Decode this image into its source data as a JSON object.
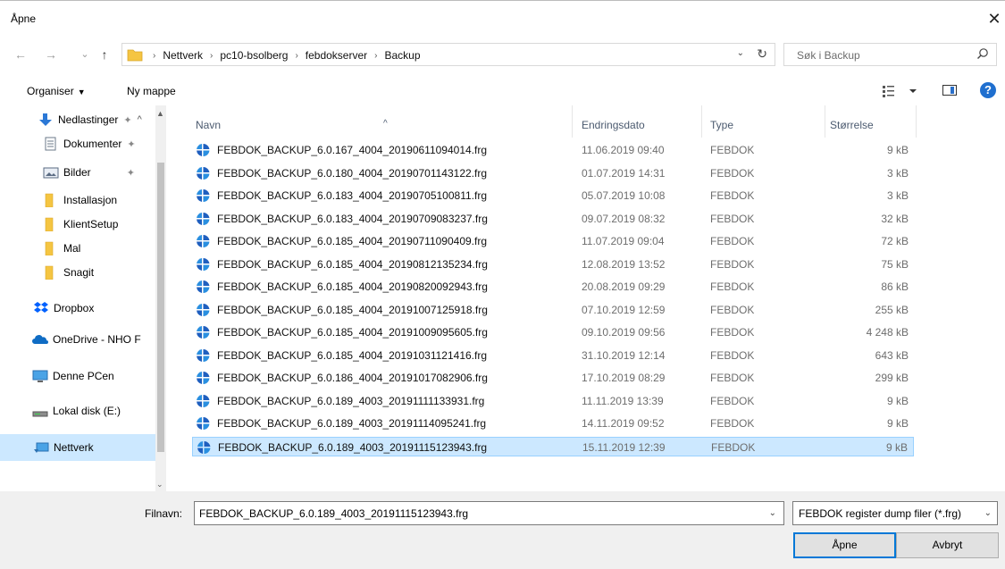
{
  "window": {
    "title": "Åpne",
    "close_glyph": "✕"
  },
  "nav": {
    "back": "←",
    "forward": "→",
    "recent": "⌄",
    "up": "↑",
    "breadcrumb": [
      "Nettverk",
      "pc10-bsolberg",
      "febdokserver",
      "Backup"
    ],
    "search_placeholder": "Søk i Backup"
  },
  "toolbar": {
    "organize": "Organiser",
    "new_folder": "Ny mappe",
    "help": "?"
  },
  "sidebar": {
    "items": [
      {
        "label": "Nedlastinger",
        "icon": "download-icon",
        "pinned": true
      },
      {
        "label": "Dokumenter",
        "icon": "documents-icon",
        "pinned": true
      },
      {
        "label": "Bilder",
        "icon": "pictures-icon",
        "pinned": true
      },
      {
        "label": "Installasjon",
        "icon": "folder-icon"
      },
      {
        "label": "KlientSetup",
        "icon": "folder-icon"
      },
      {
        "label": "Mal",
        "icon": "folder-icon"
      },
      {
        "label": "Snagit",
        "icon": "folder-icon"
      },
      {
        "label": "Dropbox",
        "icon": "dropbox-icon"
      },
      {
        "label": "OneDrive - NHO F",
        "icon": "onedrive-icon"
      },
      {
        "label": "Denne PCen",
        "icon": "computer-icon"
      },
      {
        "label": "Lokal disk (E:)",
        "icon": "drive-icon"
      },
      {
        "label": "Nettverk",
        "icon": "network-icon",
        "selected": true
      }
    ]
  },
  "columns": {
    "name": "Navn",
    "date": "Endringsdato",
    "type": "Type",
    "size": "Størrelse"
  },
  "files": [
    {
      "name": "FEBDOK_BACKUP_6.0.167_4004_20190611094014.frg",
      "date": "11.06.2019 09:40",
      "type": "FEBDOK",
      "size": "9 kB"
    },
    {
      "name": "FEBDOK_BACKUP_6.0.180_4004_20190701143122.frg",
      "date": "01.07.2019 14:31",
      "type": "FEBDOK",
      "size": "3 kB"
    },
    {
      "name": "FEBDOK_BACKUP_6.0.183_4004_20190705100811.frg",
      "date": "05.07.2019 10:08",
      "type": "FEBDOK",
      "size": "3 kB"
    },
    {
      "name": "FEBDOK_BACKUP_6.0.183_4004_20190709083237.frg",
      "date": "09.07.2019 08:32",
      "type": "FEBDOK",
      "size": "32 kB"
    },
    {
      "name": "FEBDOK_BACKUP_6.0.185_4004_20190711090409.frg",
      "date": "11.07.2019 09:04",
      "type": "FEBDOK",
      "size": "72 kB"
    },
    {
      "name": "FEBDOK_BACKUP_6.0.185_4004_20190812135234.frg",
      "date": "12.08.2019 13:52",
      "type": "FEBDOK",
      "size": "75 kB"
    },
    {
      "name": "FEBDOK_BACKUP_6.0.185_4004_20190820092943.frg",
      "date": "20.08.2019 09:29",
      "type": "FEBDOK",
      "size": "86 kB"
    },
    {
      "name": "FEBDOK_BACKUP_6.0.185_4004_20191007125918.frg",
      "date": "07.10.2019 12:59",
      "type": "FEBDOK",
      "size": "255 kB"
    },
    {
      "name": "FEBDOK_BACKUP_6.0.185_4004_20191009095605.frg",
      "date": "09.10.2019 09:56",
      "type": "FEBDOK",
      "size": "4 248 kB"
    },
    {
      "name": "FEBDOK_BACKUP_6.0.185_4004_20191031121416.frg",
      "date": "31.10.2019 12:14",
      "type": "FEBDOK",
      "size": "643 kB"
    },
    {
      "name": "FEBDOK_BACKUP_6.0.186_4004_20191017082906.frg",
      "date": "17.10.2019 08:29",
      "type": "FEBDOK",
      "size": "299 kB"
    },
    {
      "name": "FEBDOK_BACKUP_6.0.189_4003_20191111133931.frg",
      "date": "11.11.2019 13:39",
      "type": "FEBDOK",
      "size": "9 kB"
    },
    {
      "name": "FEBDOK_BACKUP_6.0.189_4003_20191114095241.frg",
      "date": "14.11.2019 09:52",
      "type": "FEBDOK",
      "size": "9 kB"
    },
    {
      "name": "FEBDOK_BACKUP_6.0.189_4003_20191115123943.frg",
      "date": "15.11.2019 12:39",
      "type": "FEBDOK",
      "size": "9 kB",
      "selected": true
    }
  ],
  "footer": {
    "filename_label": "Filnavn:",
    "filename_value": "FEBDOK_BACKUP_6.0.189_4003_20191115123943.frg",
    "filetype_value": "FEBDOK register dump filer (*.frg)",
    "open_button": "Åpne",
    "cancel_button": "Avbryt"
  },
  "colors": {
    "selection": "#cce8ff",
    "selection_border": "#99d1ff",
    "accent": "#0078d7",
    "folder": "#f5c542"
  }
}
